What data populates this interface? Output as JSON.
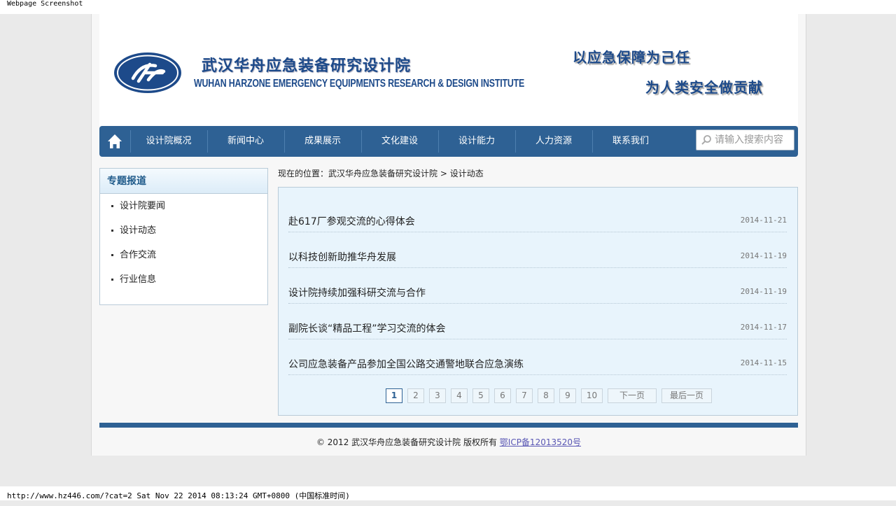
{
  "screenshot_caption": "Webpage Screenshot",
  "status_line": "http://www.hz446.com/?cat=2 Sat Nov 22 2014 08:13:24 GMT+0800 (中国标准时间)",
  "header": {
    "brand_cn": "武汉华舟应急装备研究设计院",
    "brand_en": "WUHAN HARZONE EMERGENCY EQUIPMENTS RESEARCH & DESIGN INSTITUTE",
    "slogan_line1": "以应急保障为己任",
    "slogan_line2": "为人类安全做贡献",
    "logo_icon": "harzone-logo-icon",
    "brand_color": "#1d4a8a"
  },
  "nav": {
    "home_icon": "home-icon",
    "items": [
      "设计院概况",
      "新闻中心",
      "成果展示",
      "文化建设",
      "设计能力",
      "人力资源",
      "联系我们"
    ],
    "search_placeholder": "请输入搜索内容",
    "bar_color": "#2e6194"
  },
  "sidebar": {
    "title": "专题报道",
    "items": [
      "设计院要闻",
      "设计动态",
      "合作交流",
      "行业信息"
    ]
  },
  "breadcrumb": {
    "prefix": "现在的位置：",
    "home": "武汉华舟应急装备研究设计院",
    "separator": ">",
    "current": "设计动态"
  },
  "news": [
    {
      "title": "赴617厂参观交流的心得体会",
      "date": "2014-11-21"
    },
    {
      "title": "以科技创新助推华舟发展",
      "date": "2014-11-19"
    },
    {
      "title": "设计院持续加强科研交流与合作",
      "date": "2014-11-19"
    },
    {
      "title": "副院长谈“精品工程”学习交流的体会",
      "date": "2014-11-17"
    },
    {
      "title": "公司应急装备产品参加全国公路交通警地联合应急演练",
      "date": "2014-11-15"
    }
  ],
  "pagination": {
    "pages": [
      "1",
      "2",
      "3",
      "4",
      "5",
      "6",
      "7",
      "8",
      "9",
      "10"
    ],
    "current_page": "1",
    "next_label": "下一页",
    "last_label": "最后一页"
  },
  "footer": {
    "copyright": "© 2012 武汉华舟应急装备研究设计院 版权所有",
    "icp": "鄂ICP备12013520号"
  }
}
